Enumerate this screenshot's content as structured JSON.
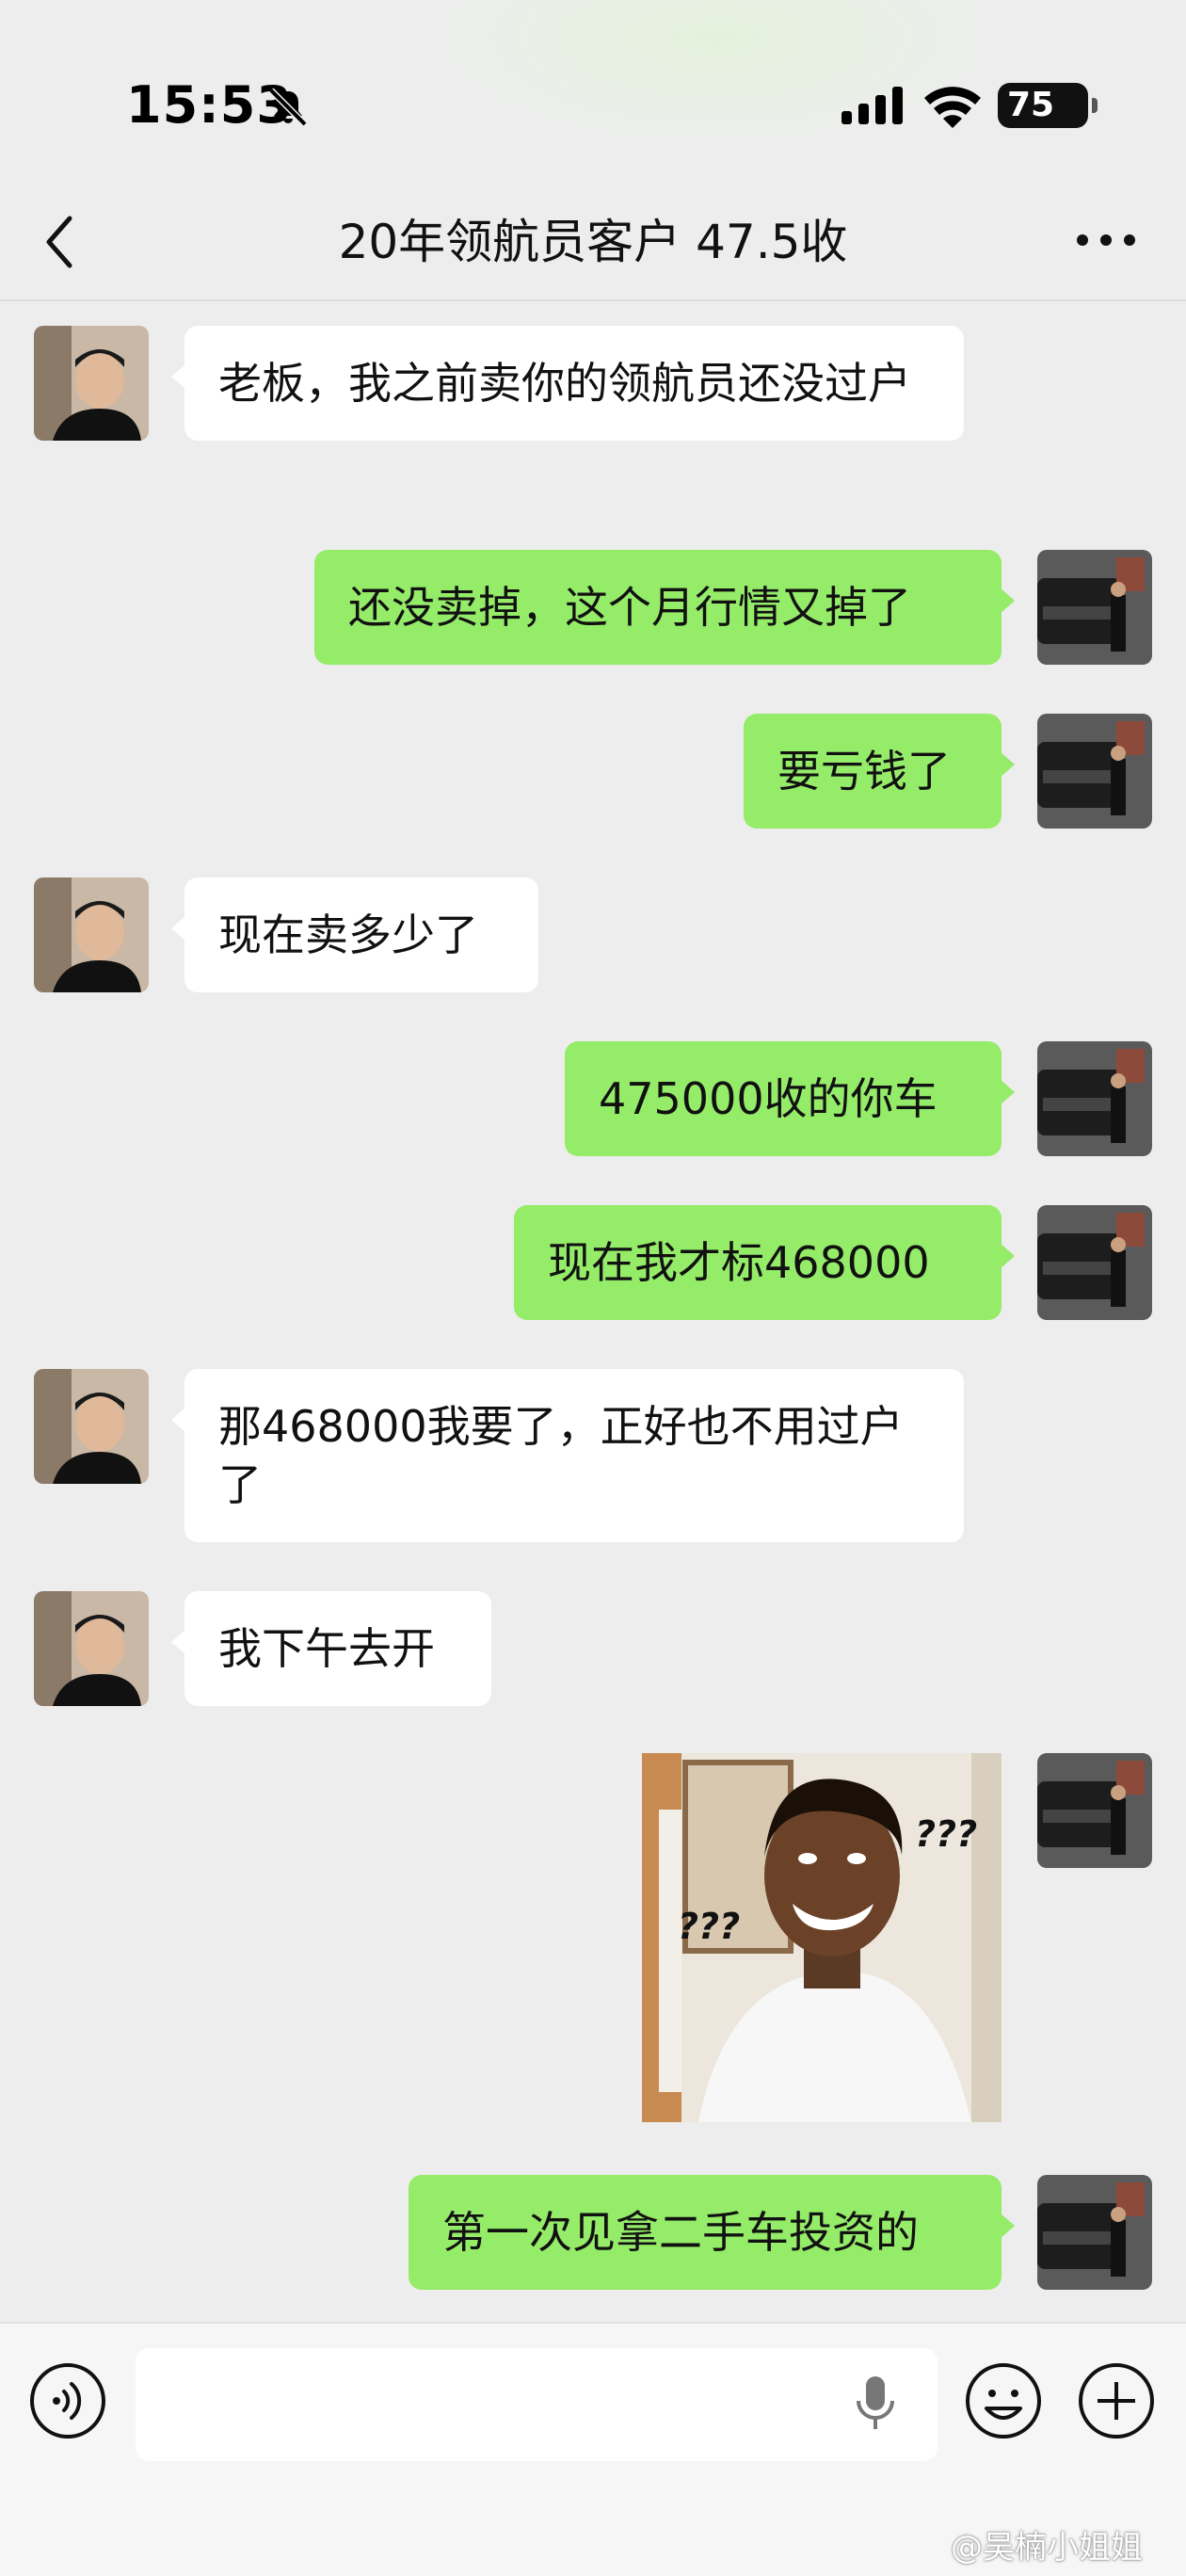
{
  "status_bar": {
    "time": "15:53",
    "battery": "75"
  },
  "header": {
    "title": "20年领航员客户 47.5收"
  },
  "messages": [
    {
      "side": "in",
      "text": "老板，我之前卖你的领航员还没过户"
    },
    {
      "side": "out",
      "text": "还没卖掉，这个月行情又掉了"
    },
    {
      "side": "out",
      "text": "要亏钱了"
    },
    {
      "side": "in",
      "text": "现在卖多少了"
    },
    {
      "side": "out",
      "text": "475000收的你车"
    },
    {
      "side": "out",
      "text": "现在我才标468000"
    },
    {
      "side": "in",
      "text": "那468000我要了，正好也不用过户了"
    },
    {
      "side": "in",
      "text": "我下午去开"
    },
    {
      "side": "out",
      "type": "sticker",
      "text_left": "???",
      "text_right": "???"
    },
    {
      "side": "out",
      "text": "第一次见拿二手车投资的"
    }
  ],
  "watermark": "@吴楠小姐姐",
  "icons": {
    "back": "chevron-left-icon",
    "more": "more-dots-icon",
    "voice": "voice-icon",
    "mic": "microphone-icon",
    "emoji": "emoji-icon",
    "plus": "plus-icon",
    "bell": "bell-slash-icon"
  },
  "colors": {
    "outgoing_bubble": "#95ec69",
    "incoming_bubble": "#ffffff",
    "background": "#ededed"
  }
}
